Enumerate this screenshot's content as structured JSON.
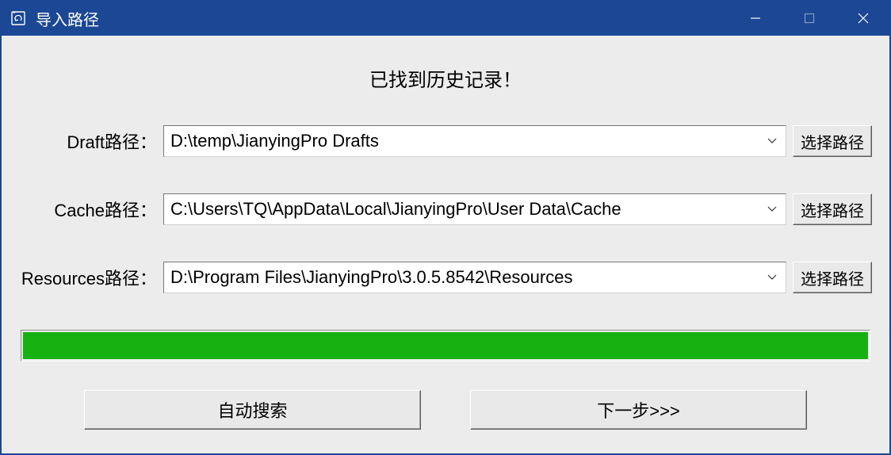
{
  "window": {
    "title": "导入路径"
  },
  "status": "已找到历史记录！",
  "fields": {
    "draft": {
      "label": "Draft路径：",
      "value": "D:\\temp\\JianyingPro Drafts",
      "browse": "选择路径"
    },
    "cache": {
      "label": "Cache路径：",
      "value": "C:\\Users\\TQ\\AppData\\Local\\JianyingPro\\User Data\\Cache",
      "browse": "选择路径"
    },
    "resources": {
      "label": "Resources路径：",
      "value": "D:\\Program Files\\JianyingPro\\3.0.5.8542\\Resources",
      "browse": "选择路径"
    }
  },
  "progress": {
    "percent": 100
  },
  "actions": {
    "auto_search": "自动搜索",
    "next": "下一步>>>"
  }
}
